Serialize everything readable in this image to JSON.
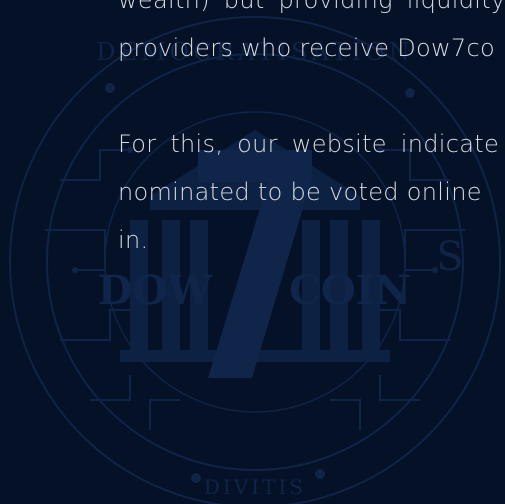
{
  "watermark": {
    "top_arc_text": "DEMOCRATISATION",
    "bottom_arc_text": "DIVITIS",
    "center_numeral": "7",
    "left_word": "DOW",
    "right_word": "COIN",
    "side_letter": "S",
    "color": "#0f2446"
  },
  "content": {
    "lines": [
      "wealth) but providing liquidity",
      "providers who receive Dow7co",
      "",
      " For this, our website indicate",
      "nominated to be voted online",
      "in."
    ]
  },
  "colors": {
    "background": "#051127",
    "text": "#d7dce4"
  }
}
